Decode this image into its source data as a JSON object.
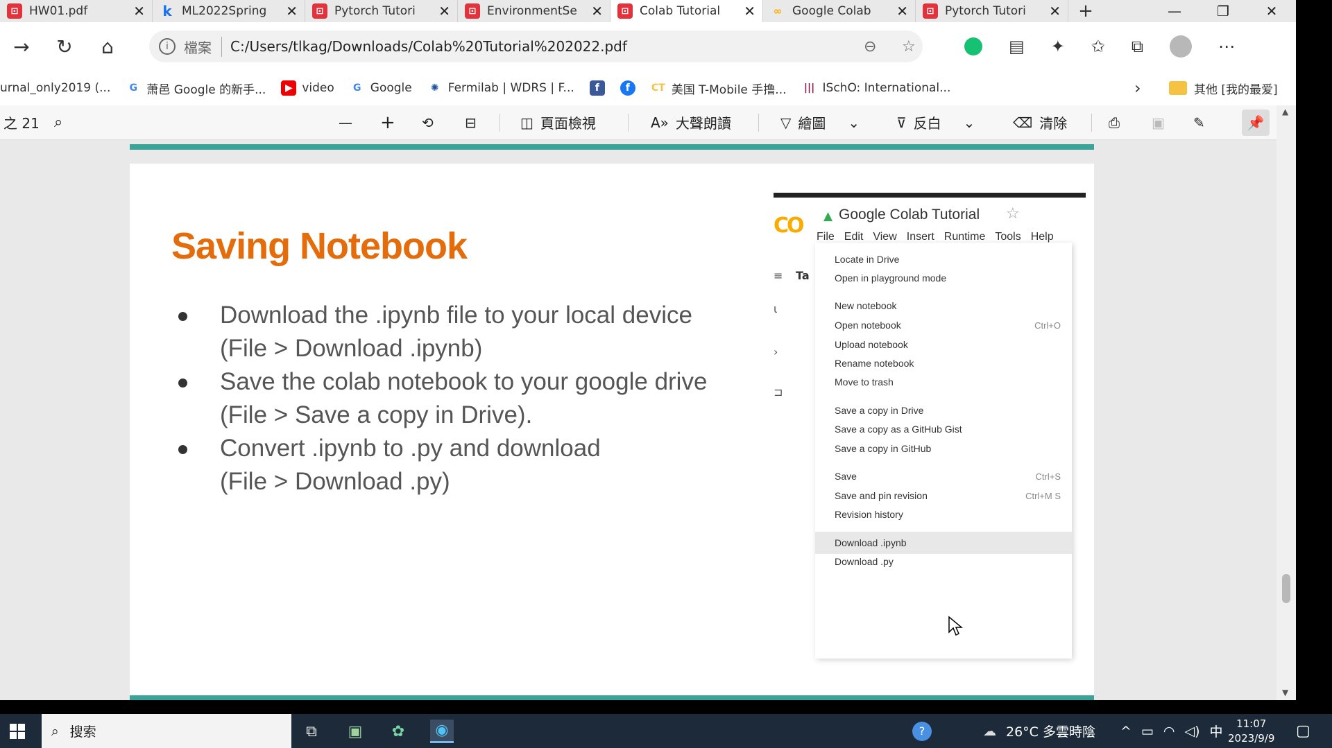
{
  "browser": {
    "tabs": [
      {
        "label": "HW01.pdf",
        "icon": "pdf-icon"
      },
      {
        "label": "ML2022Spring",
        "icon": "kaggle-icon"
      },
      {
        "label": "Pytorch Tutori",
        "icon": "pdf-icon"
      },
      {
        "label": "EnvironmentSe",
        "icon": "pdf-icon"
      },
      {
        "label": "Colab Tutorial",
        "icon": "pdf-icon",
        "active": true
      },
      {
        "label": "Google Colab",
        "icon": "colab-icon"
      },
      {
        "label": "Pytorch Tutori",
        "icon": "pdf-icon"
      }
    ],
    "address": {
      "file_label": "檔案",
      "url": "C:/Users/tlkag/Downloads/Colab%20Tutorial%202022.pdf"
    },
    "bookmarks": [
      {
        "label": "urnal_only2019 (...",
        "icon": "none"
      },
      {
        "label": "萧邑 Google 的新手...",
        "icon": "google-icon"
      },
      {
        "label": "video",
        "icon": "youtube-icon"
      },
      {
        "label": "Google",
        "icon": "google-icon"
      },
      {
        "label": "Fermilab | WDRS | F...",
        "icon": "fermilab-icon"
      },
      {
        "label": "",
        "icon": "facebook-icon"
      },
      {
        "label": "",
        "icon": "facebook-circle-icon"
      },
      {
        "label": "美国 T-Mobile 手撸...",
        "icon": "tmobile-icon"
      },
      {
        "label": "ISchO: International...",
        "icon": "ischo-icon"
      }
    ],
    "bookmarks_folder": "其他 [我的最爱]"
  },
  "pdf_toolbar": {
    "page_counter": "之 21",
    "page_view_label": "頁面檢視",
    "read_aloud_label": "大聲朗讀",
    "draw_label": "繪圖",
    "highlight_label": "反白",
    "erase_label": "清除"
  },
  "slide": {
    "title": "Saving Notebook",
    "bullets": [
      {
        "line1": "Download the .ipynb file to your local device",
        "line2": "(File > Download .ipynb)"
      },
      {
        "line1": "Save the colab notebook to your google drive",
        "line2": "(File > Save a copy in Drive)."
      },
      {
        "line1": "Convert .ipynb to .py and download",
        "line2": "(File > Download .py)"
      }
    ]
  },
  "colab": {
    "logo": "CO",
    "title": "Google Colab Tutorial",
    "menus": [
      "File",
      "Edit",
      "View",
      "Insert",
      "Runtime",
      "Tools",
      "Help"
    ],
    "side_glyph": "Ta",
    "file_menu": [
      {
        "label": "Locate in Drive",
        "shortcut": ""
      },
      {
        "label": "Open in playground mode",
        "shortcut": ""
      },
      {
        "label": "New notebook",
        "shortcut": ""
      },
      {
        "label": "Open notebook",
        "shortcut": "Ctrl+O"
      },
      {
        "label": "Upload notebook",
        "shortcut": ""
      },
      {
        "label": "Rename notebook",
        "shortcut": ""
      },
      {
        "label": "Move to trash",
        "shortcut": ""
      },
      {
        "label": "Save a copy in Drive",
        "shortcut": ""
      },
      {
        "label": "Save a copy as a GitHub Gist",
        "shortcut": ""
      },
      {
        "label": "Save a copy in GitHub",
        "shortcut": ""
      },
      {
        "label": "Save",
        "shortcut": "Ctrl+S"
      },
      {
        "label": "Save and pin revision",
        "shortcut": "Ctrl+M S"
      },
      {
        "label": "Revision history",
        "shortcut": ""
      },
      {
        "label": "Download .ipynb",
        "shortcut": "",
        "highlighted": true
      },
      {
        "label": "Download .py",
        "shortcut": ""
      }
    ]
  },
  "taskbar": {
    "search_placeholder": "搜索",
    "weather": "26°C 多雲時陰",
    "ime": "中",
    "time": "11:07",
    "date": "2023/9/9"
  },
  "colors": {
    "accent_title": "#e46c0a",
    "teal_bar": "#3aa39a",
    "taskbar_bg": "#1c2a3a"
  }
}
